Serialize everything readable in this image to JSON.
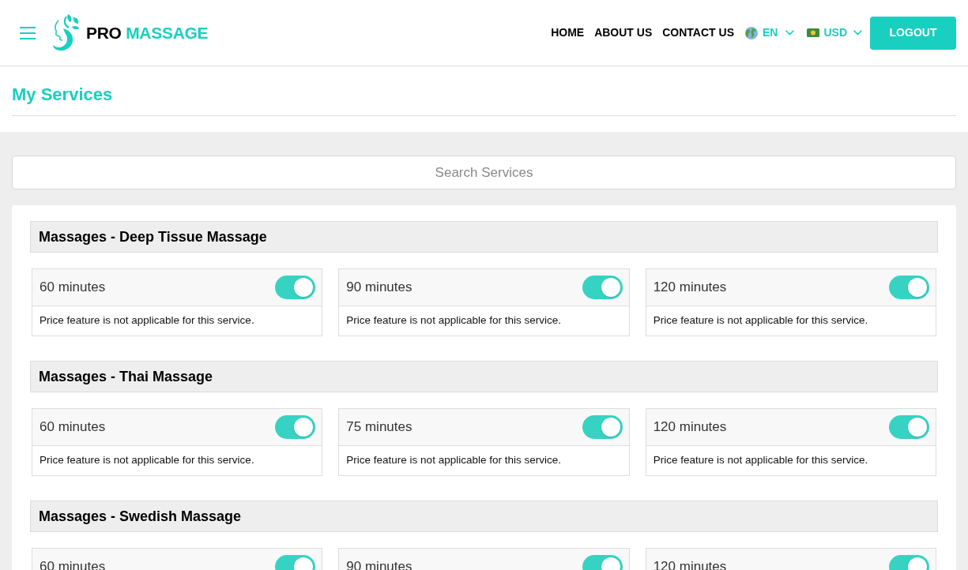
{
  "header": {
    "logo": {
      "prefix": "PRO",
      "name": "MASSAGE"
    },
    "nav": [
      "HOME",
      "ABOUT US",
      "CONTACT US"
    ],
    "language": "EN",
    "currency": "USD",
    "logout": "LOGOUT"
  },
  "page_title": "My Services",
  "search": {
    "placeholder": "Search Services"
  },
  "categories": [
    {
      "title": "Massages - Deep Tissue Massage",
      "options": [
        {
          "duration": "60 minutes",
          "on": true,
          "note": "Price feature is not applicable for this service."
        },
        {
          "duration": "90 minutes",
          "on": true,
          "note": "Price feature is not applicable for this service."
        },
        {
          "duration": "120 minutes",
          "on": true,
          "note": "Price feature is not applicable for this service."
        }
      ]
    },
    {
      "title": "Massages - Thai Massage",
      "options": [
        {
          "duration": "60 minutes",
          "on": true,
          "note": "Price feature is not applicable for this service."
        },
        {
          "duration": "75 minutes",
          "on": true,
          "note": "Price feature is not applicable for this service."
        },
        {
          "duration": "120 minutes",
          "on": true,
          "note": "Price feature is not applicable for this service."
        }
      ]
    },
    {
      "title": "Massages - Swedish Massage",
      "options": [
        {
          "duration": "60 minutes",
          "on": true
        },
        {
          "duration": "90 minutes",
          "on": true
        },
        {
          "duration": "120 minutes",
          "on": true
        }
      ]
    }
  ]
}
